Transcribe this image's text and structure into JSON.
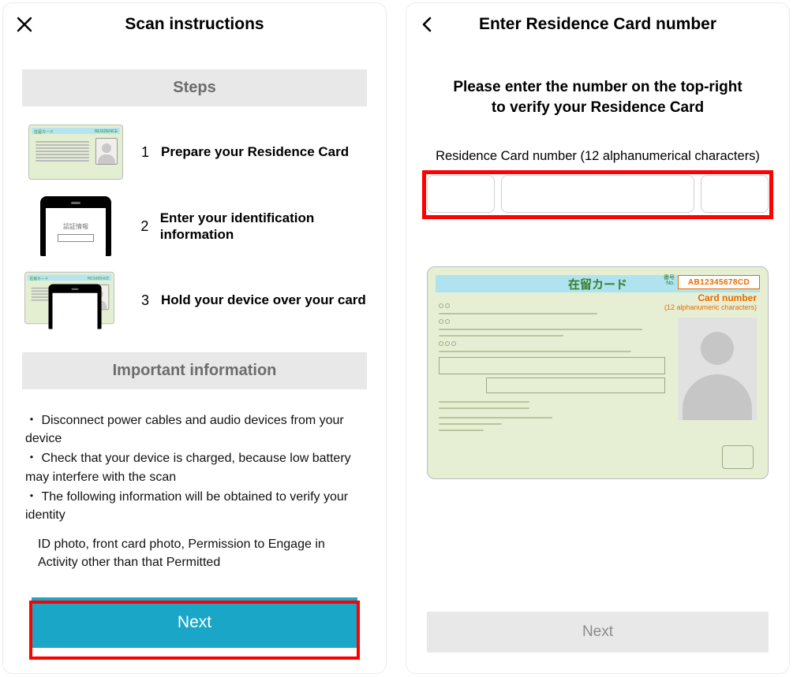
{
  "screen1": {
    "title": "Scan instructions",
    "steps_header": "Steps",
    "steps": [
      {
        "num": "1",
        "text": "Prepare your Residence Card"
      },
      {
        "num": "2",
        "text": "Enter your identification information",
        "phone_label": "認証情報"
      },
      {
        "num": "3",
        "text": "Hold your device over your card"
      }
    ],
    "card_label_jp": "在留カード",
    "card_label_en": "RESIDENCE",
    "important_header": "Important  information",
    "important_bullets": [
      "・ Disconnect power cables and audio devices from your device",
      "・ Check that your device is charged, because low battery may interfere with the scan",
      "・ The following information will be obtained to verify your identity"
    ],
    "obtained_text": "ID photo, front card photo, Permission to Engage in Activity other than that Permitted",
    "next_label": "Next"
  },
  "screen2": {
    "title": "Enter Residence Card number",
    "prompt_line1": "Please enter the number on the top-right",
    "prompt_line2": "to verify your Residence Card",
    "field_label": "Residence Card number (12 alphanumerical characters)",
    "sample": {
      "title_jp": "在留カード",
      "number_kanji": "番号",
      "number_en": "No.",
      "sample_number": "AB12345678CD",
      "card_number_label": "Card number",
      "card_number_sub": "(12 alphanumeric characters)"
    },
    "next_label": "Next"
  }
}
